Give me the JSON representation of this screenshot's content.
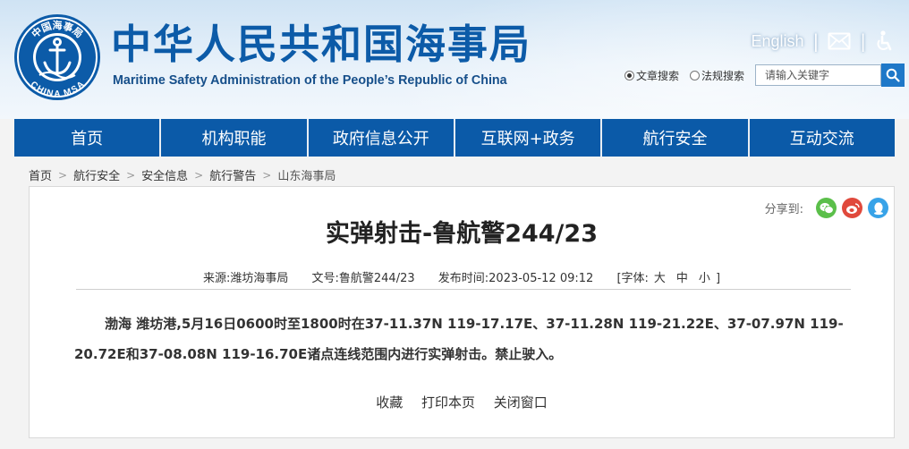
{
  "header": {
    "title_cn": "中华人民共和国海事局",
    "title_en": "Maritime Safety Administration of the People’s Republic of China",
    "logo_text_top": "中国海事局",
    "logo_text_bottom": "CHINA MSA",
    "english_link": "English",
    "separator": "|",
    "email_icon": "mail-icon",
    "accessibility_icon": "accessibility-icon"
  },
  "search": {
    "option_article": "文章搜索",
    "option_law": "法规搜索",
    "selected": "文章搜索",
    "placeholder": "请输入关键字",
    "button_icon": "search-icon"
  },
  "nav": {
    "items": [
      "首页",
      "机构职能",
      "政府信息公开",
      "互联网+政务",
      "航行安全",
      "互动交流"
    ]
  },
  "breadcrumb": {
    "items": [
      "首页",
      "航行安全",
      "安全信息",
      "航行警告",
      "山东海事局"
    ],
    "separator": ">"
  },
  "article": {
    "share_label": "分享到:",
    "share_icons": [
      "wechat-icon",
      "weibo-icon",
      "qq-icon"
    ],
    "title": "实弹射击-鲁航警244/23",
    "source": "来源:潍坊海事局",
    "doc_no": "文号:鲁航警244/23",
    "publish_time": "发布时间:2023-05-12 09:12",
    "font_label_open": "[字体:",
    "font_large": "大",
    "font_medium": "中",
    "font_small": "小",
    "font_label_close": "]",
    "body": "渤海 潍坊港,5月16日0600时至1800时在37-11.37N 119-17.17E、37-11.28N 119-21.22E、37-07.97N 119-20.72E和37-08.08N 119-16.70E诸点连线范围内进行实弹射击。禁止驶入。",
    "action_favorite": "收藏",
    "action_print": "打印本页",
    "action_close": "关闭窗口"
  },
  "colors": {
    "brand_blue": "#0b5aa8",
    "title_blue": "#0c5ba8",
    "wechat": "#5bbf4a",
    "weibo": "#e0493c",
    "qq": "#38a3e8"
  }
}
